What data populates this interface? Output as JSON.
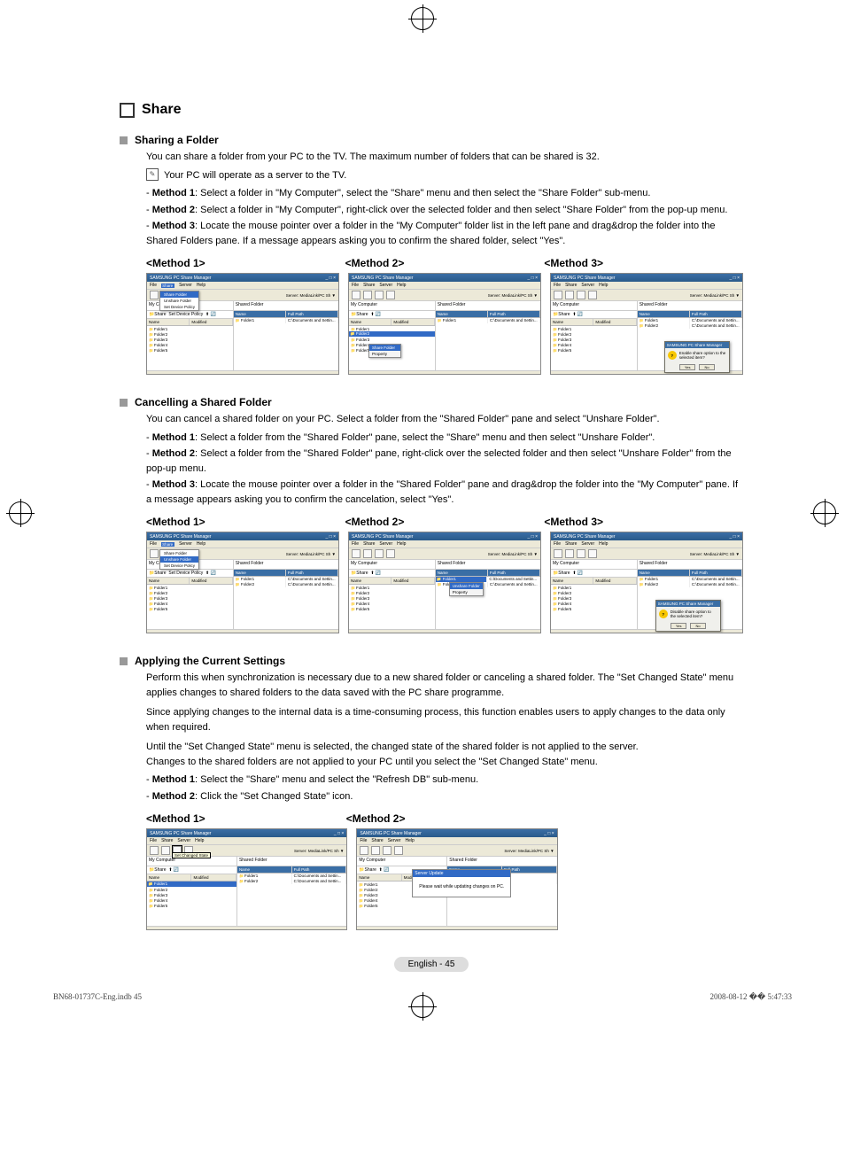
{
  "main_title": "Share",
  "footer_page": "English - 45",
  "print_footer_left": "BN68-01737C-Eng.indb   45",
  "print_footer_right": "2008-08-12   �� 5:47:33",
  "app": {
    "title": "SAMSUNG PC Share Manager",
    "menus": [
      "File",
      "Share",
      "Server",
      "Help"
    ],
    "server_label": "Server:",
    "server_value": "MediaLink/PC Sh  ▼",
    "left_header": "My Computer",
    "nav_refresh": "Refresh",
    "nav_share": "Share",
    "nav_policy": "Set Device Policy",
    "right_header": "Shared Folder",
    "left_cols": [
      "Name",
      "Modified"
    ],
    "right_cols": [
      "Name",
      "Full Path"
    ],
    "folders": [
      "Folder1",
      "Folder2",
      "Folder3",
      "Folder4",
      "Folder5"
    ],
    "shared_one": "Folder1",
    "shared_path": "C:\\Documents and Settin...",
    "shared_two": "Folder2"
  },
  "sections": {
    "sharing": {
      "title": "Sharing a Folder",
      "intro": "You can share a folder from your PC to the TV.  The maximum number of folders that can be shared is 32.",
      "note": "Your PC will operate as a server to the TV.",
      "m1_label": "Method 1",
      "m1_text": ": Select a folder in \"My Computer\", select the \"Share\" menu and then select the \"Share Folder\" sub-menu.",
      "m2_label": "Method 2",
      "m2_text": ": Select a folder in \"My Computer\", right-click over the selected folder and then select \"Share Folder\" from the pop-up menu.",
      "m3_label": "Method 3",
      "m3_text": ": Locate the mouse pointer over a folder in the \"My Computer\" folder list in the left pane and drag&drop the folder into the Shared Folders pane. If a message appears asking you to confirm the shared folder, select \"Yes\".",
      "method_headers": [
        "<Method 1>",
        "<Method 2>",
        "<Method 3>"
      ],
      "share_menu": {
        "items": [
          "Share Folder",
          "Unshare Folder",
          "Set Device Policy"
        ]
      },
      "ctx_share": {
        "items": [
          "Share Folder",
          "Property"
        ]
      },
      "dialog": {
        "title": "SAMSUNG PC Share Manager",
        "msg": "Enable share option to the selected item?",
        "yes": "Yes",
        "no": "No"
      }
    },
    "cancel": {
      "title": "Cancelling a Shared Folder",
      "intro": "You can cancel a shared folder on your PC. Select a folder from the \"Shared Folder\" pane and select \"Unshare Folder\".",
      "m1_label": "Method 1",
      "m1_text": ": Select a folder from the \"Shared Folder\" pane, select the \"Share\" menu and then select \"Unshare Folder\".",
      "m2_label": "Method 2",
      "m2_text": ": Select a folder from the \"Shared Folder\" pane, right-click over the selected folder and then select \"Unshare Folder\" from the pop-up menu.",
      "m3_label": "Method 3",
      "m3_text": ": Locate the mouse pointer over a folder in the \"Shared Folder\" pane and drag&drop the folder into the \"My Computer\" pane. If a message appears asking you to confirm the cancelation, select \"Yes\".",
      "method_headers": [
        "<Method 1>",
        "<Method 2>",
        "<Method 3>"
      ],
      "ctx_unshare": {
        "items": [
          "Unshare Folder",
          "Property"
        ]
      },
      "dialog": {
        "title": "SAMSUNG PC Share Manager",
        "msg": "Disable share option to the selected item?",
        "yes": "Yes",
        "no": "No"
      }
    },
    "apply": {
      "title": "Applying the Current Settings",
      "p1": "Perform this when synchronization is necessary due to a new shared folder or canceling a shared folder. The \"Set Changed State\" menu applies changes to shared folders to the data saved with the PC share programme.",
      "p2": "Since applying changes to the internal data is a time-consuming process, this function enables users to apply changes to the data only when required.",
      "p3": "Until the \"Set Changed State\" menu is selected, the changed state of the shared folder is not applied to the server.",
      "p4": "Changes to the shared folders are not applied to your PC until you select the \"Set Changed State\" menu.",
      "m1_label": "Method 1",
      "m1_text": ": Select the \"Share\" menu and select the \"Refresh DB\" sub-menu.",
      "m2_label": "Method 2",
      "m2_text": ": Click the \"Set Changed State\" icon.",
      "method_headers": [
        "<Method 1>",
        "<Method 2>"
      ],
      "tooltip": "Set Changed State",
      "wait": {
        "title": "Server Update",
        "msg": "Please wait while updating changes on PC."
      }
    }
  }
}
